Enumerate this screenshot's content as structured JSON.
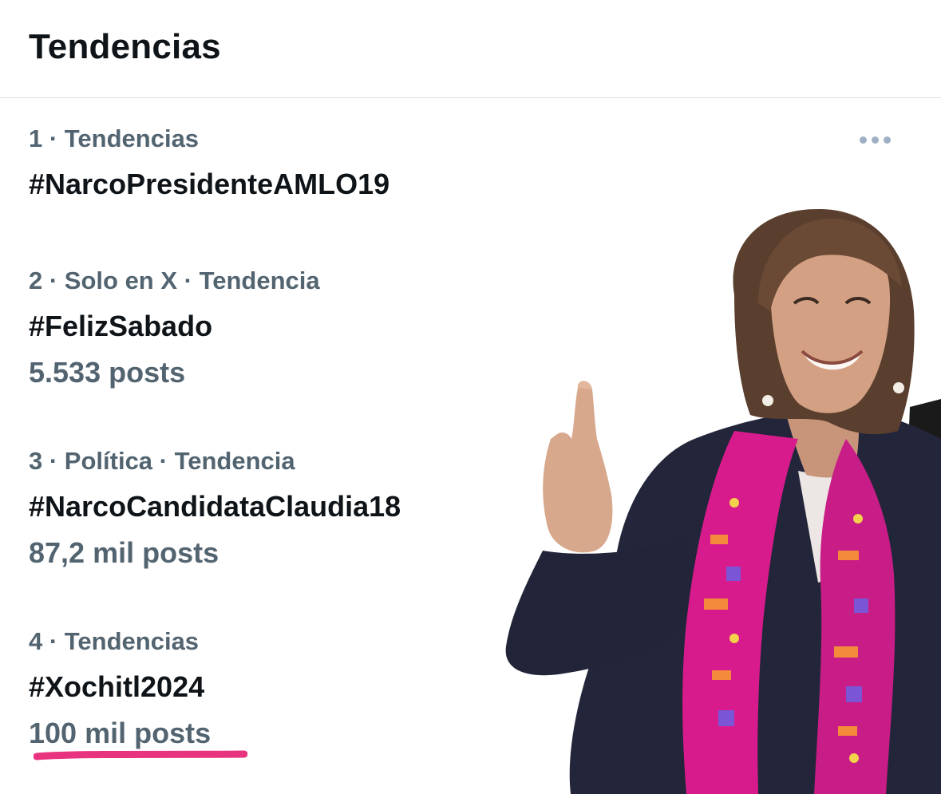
{
  "header": {
    "title": "Tendencias"
  },
  "trends": [
    {
      "meta": "1 · Tendencias",
      "name": "#NarcoPresidenteAMLO19",
      "count": ""
    },
    {
      "meta": "2 · Solo en X · Tendencia",
      "name": "#FelizSabado",
      "count": "5.533 posts"
    },
    {
      "meta": "3 · Política · Tendencia",
      "name": "#NarcoCandidataClaudia18",
      "count": "87,2 mil posts"
    },
    {
      "meta": "4 · Tendencias",
      "name": "#Xochitl2024",
      "count": "100 mil posts"
    }
  ],
  "icons": {
    "more": "more-horizontal-icon"
  },
  "colors": {
    "primary_text": "#0f1419",
    "secondary_text": "#536471",
    "more_dots": "#9fb0c4",
    "underline_highlight": "#e8347f",
    "scarf_pink": "#d81b8c"
  }
}
